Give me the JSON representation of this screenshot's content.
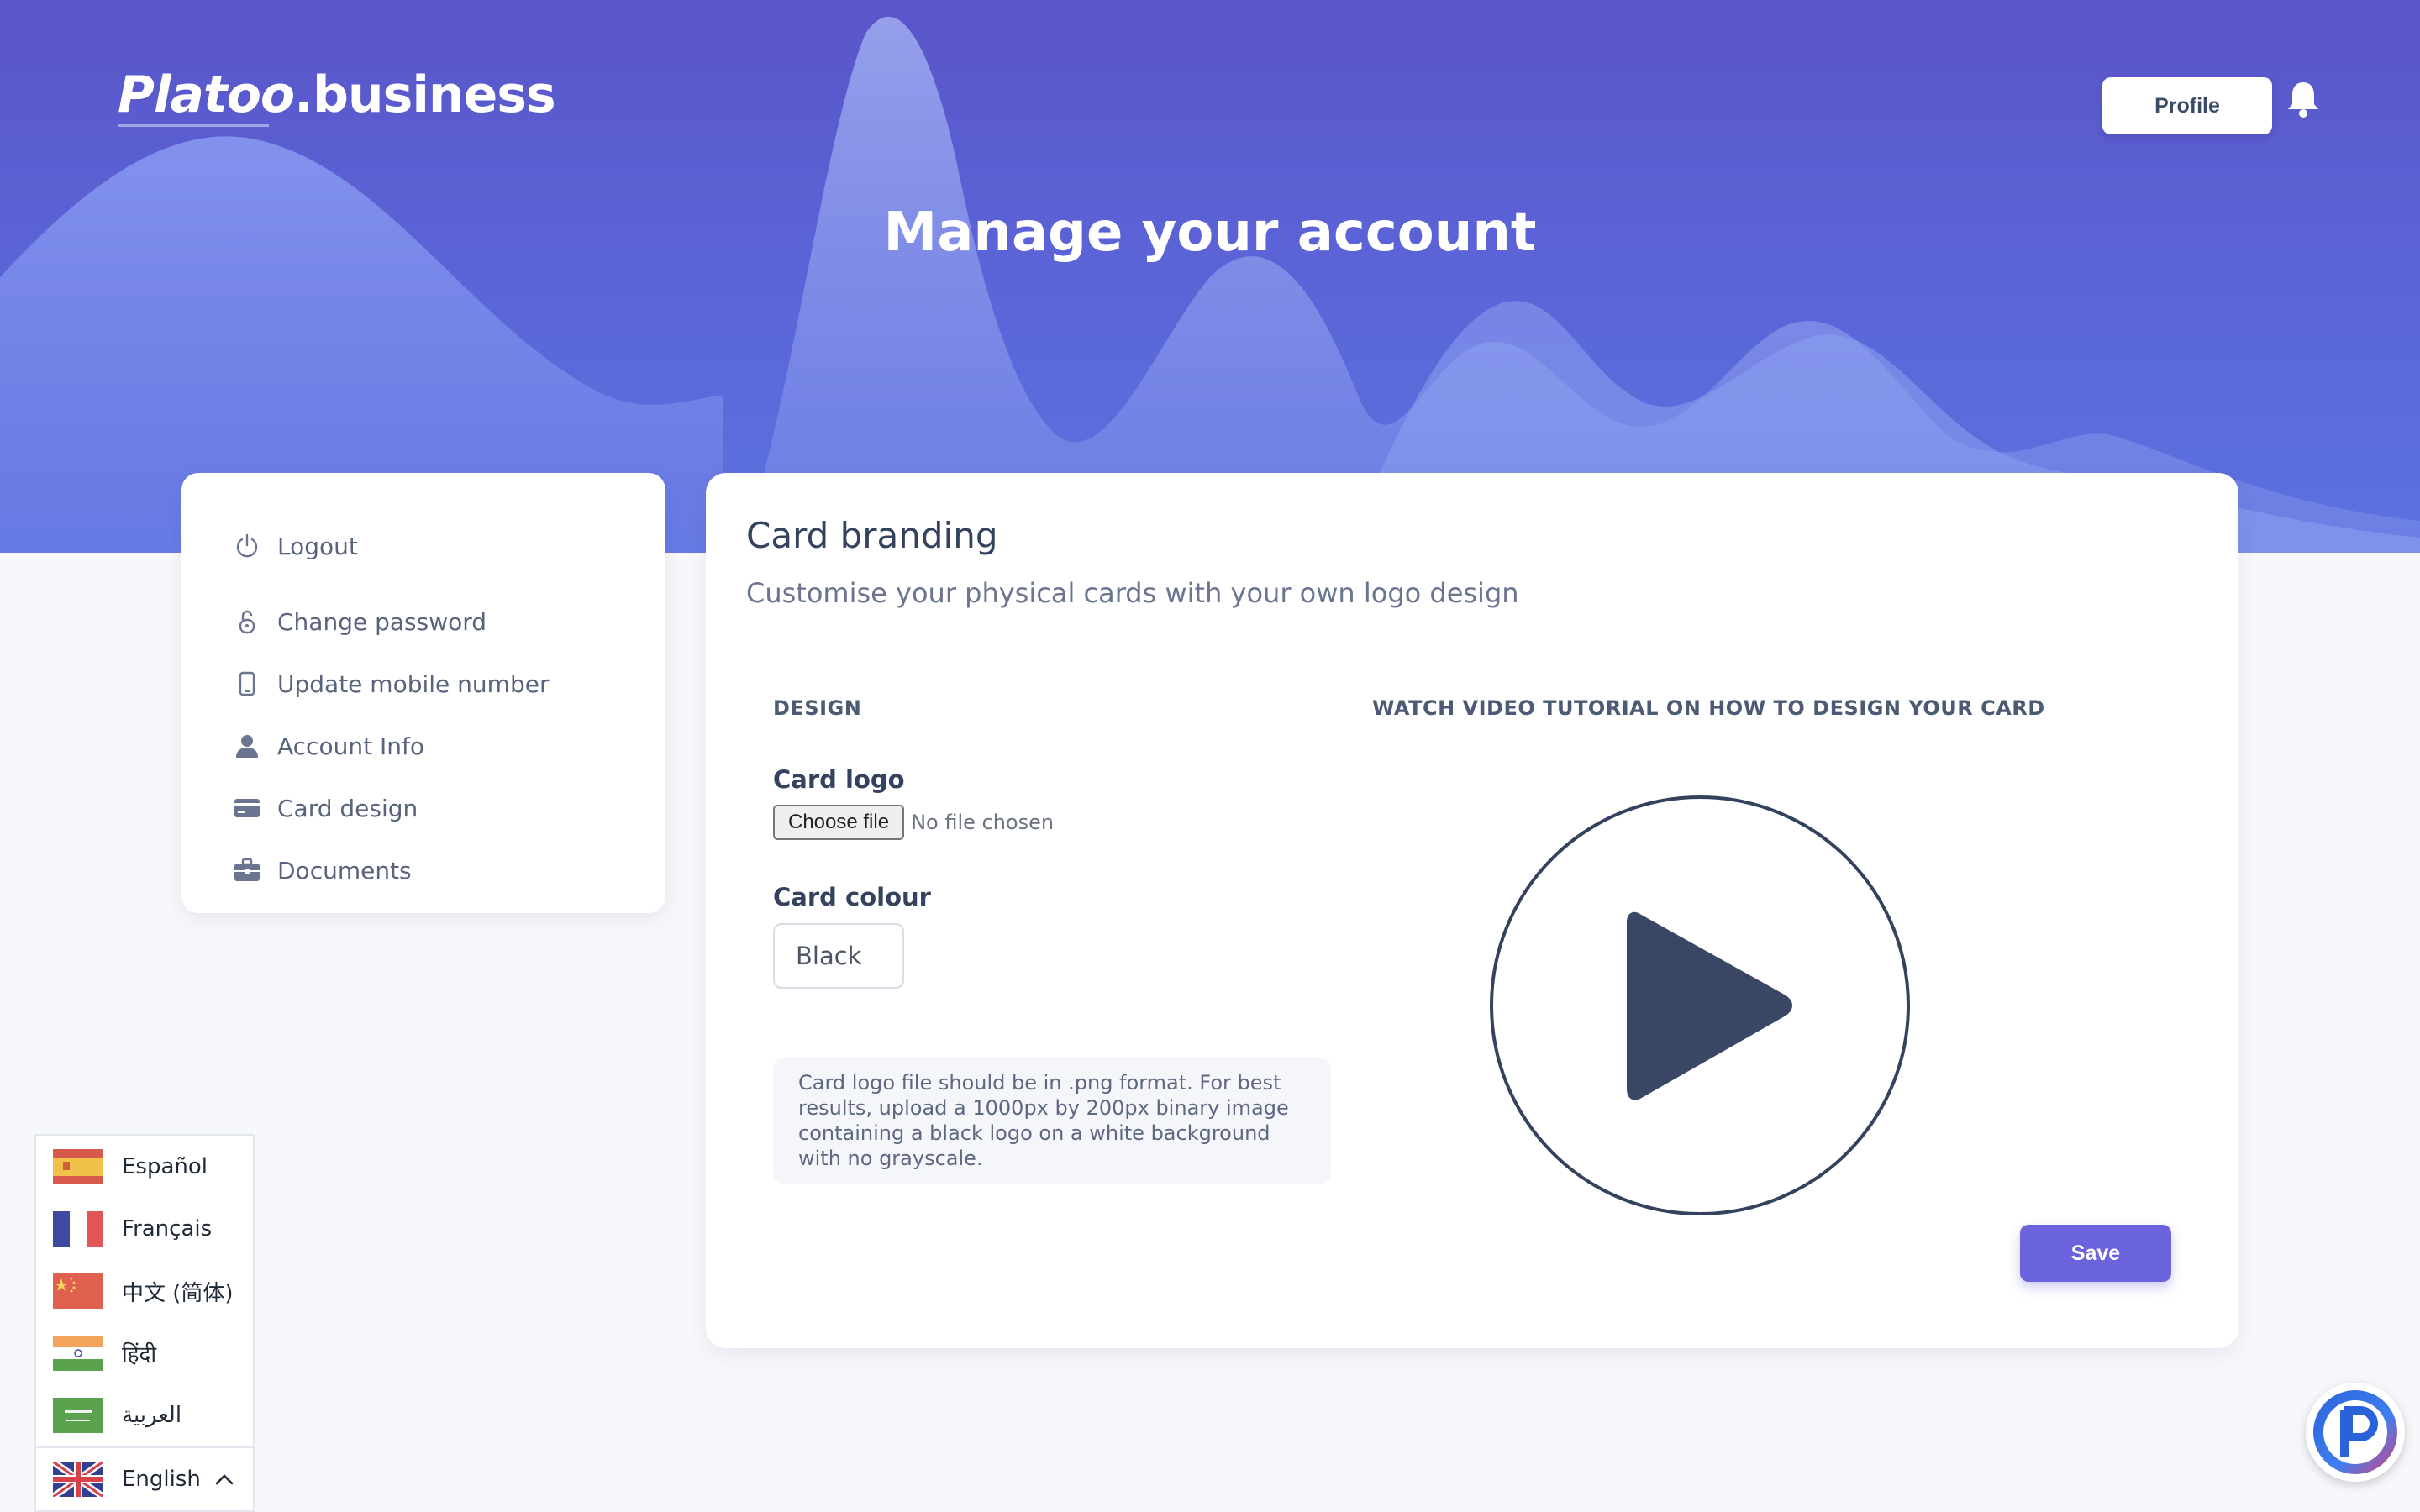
{
  "header": {
    "logo_brand": "Platoo",
    "logo_suffix": ".business",
    "profile_label": "Profile",
    "title": "Manage your account"
  },
  "sidebar": {
    "items": [
      {
        "label": "Logout",
        "icon": "power-icon"
      },
      {
        "label": "Change password",
        "icon": "lock-icon"
      },
      {
        "label": "Update mobile number",
        "icon": "phone-icon"
      },
      {
        "label": "Account Info",
        "icon": "user-icon"
      },
      {
        "label": "Card design",
        "icon": "credit-card-icon"
      },
      {
        "label": "Documents",
        "icon": "briefcase-icon"
      }
    ]
  },
  "main": {
    "title": "Card branding",
    "subtitle": "Customise your physical cards with your own logo design",
    "design_label": "DESIGN",
    "video_label": "WATCH VIDEO TUTORIAL ON HOW TO DESIGN YOUR CARD",
    "card_logo_label": "Card logo",
    "choose_file_label": "Choose file",
    "file_status": "No file chosen",
    "card_colour_label": "Card colour",
    "card_colour_value": "Black",
    "hint": "Card logo file should be in .png format. For best results, upload a 1000px by 200px binary image containing a black logo on a white background with no grayscale.",
    "save_label": "Save"
  },
  "languages": {
    "items": [
      {
        "label": "Español",
        "flag": "spain-flag-icon"
      },
      {
        "label": "Français",
        "flag": "france-flag-icon"
      },
      {
        "label": "中文 (简体)",
        "flag": "china-flag-icon"
      },
      {
        "label": "हिंदी",
        "flag": "india-flag-icon"
      },
      {
        "label": "العربية",
        "flag": "saudi-flag-icon"
      }
    ],
    "current": "English",
    "current_flag": "uk-flag-icon"
  },
  "colors": {
    "accent": "#6b63dc",
    "hero": "#5b63d6",
    "text": "#34425e"
  }
}
